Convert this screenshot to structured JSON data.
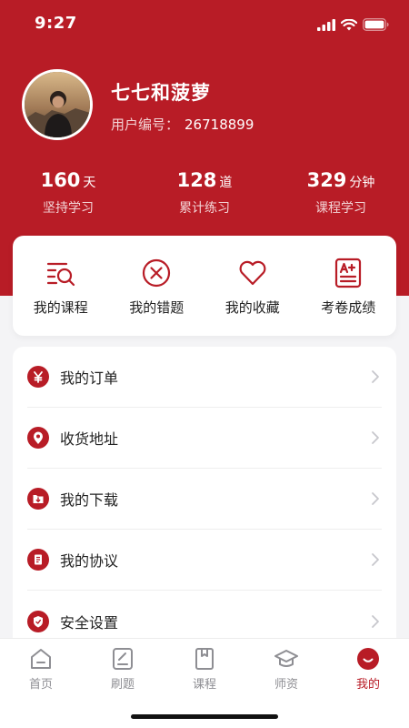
{
  "status_bar": {
    "time": "9:27"
  },
  "profile": {
    "name": "七七和菠萝",
    "id_label": "用户编号：",
    "id_value": "26718899"
  },
  "stats": [
    {
      "value": "160",
      "unit": "天",
      "label": "坚持学习"
    },
    {
      "value": "128",
      "unit": "道",
      "label": "累计练习"
    },
    {
      "value": "329",
      "unit": "分钟",
      "label": "课程学习"
    }
  ],
  "quick_actions": [
    {
      "label": "我的课程",
      "icon": "course-list-icon"
    },
    {
      "label": "我的错题",
      "icon": "wrong-question-icon"
    },
    {
      "label": "我的收藏",
      "icon": "heart-icon"
    },
    {
      "label": "考卷成绩",
      "icon": "exam-score-icon"
    }
  ],
  "menu": [
    {
      "label": "我的订单",
      "icon": "yen-icon"
    },
    {
      "label": "收货地址",
      "icon": "location-pin-icon"
    },
    {
      "label": "我的下载",
      "icon": "download-folder-icon"
    },
    {
      "label": "我的协议",
      "icon": "agreement-icon"
    },
    {
      "label": "安全设置",
      "icon": "shield-icon"
    }
  ],
  "tabs": [
    {
      "label": "首页",
      "icon": "home-icon"
    },
    {
      "label": "刷题",
      "icon": "practice-icon"
    },
    {
      "label": "课程",
      "icon": "book-icon"
    },
    {
      "label": "师资",
      "icon": "graduation-cap-icon"
    },
    {
      "label": "我的",
      "icon": "me-icon",
      "active": true
    }
  ],
  "colors": {
    "brand_red": "#b81c26",
    "inactive_gray": "#8e8e93",
    "background": "#f4f4f6"
  }
}
